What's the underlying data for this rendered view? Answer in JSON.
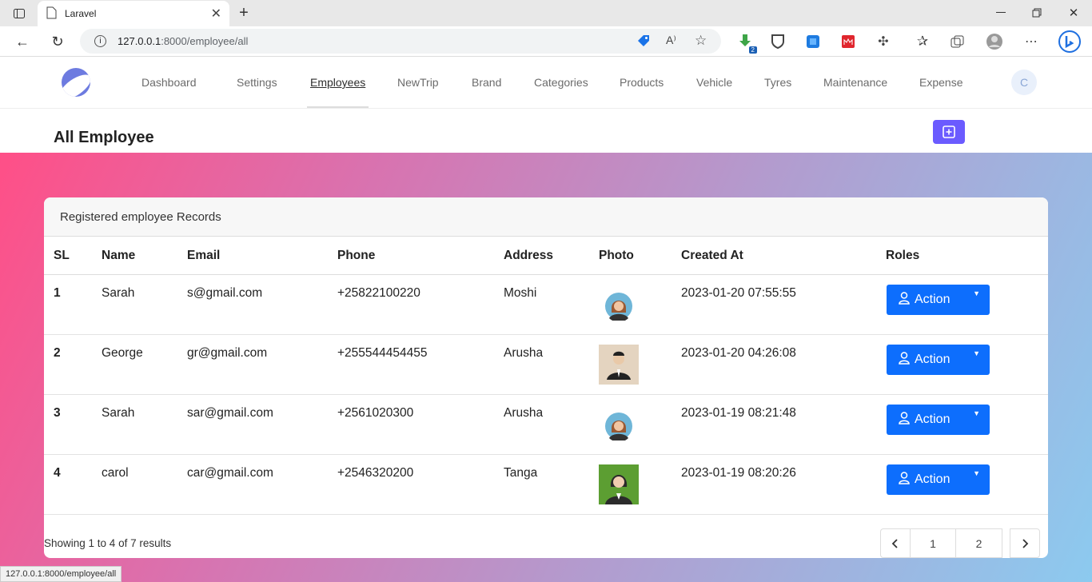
{
  "browser": {
    "tab_title": "Laravel",
    "url_host": "127.0.0.1",
    "url_rest": ":8000/employee/all",
    "status_url": "127.0.0.1:8000/employee/all",
    "extension_badge": "2"
  },
  "nav": {
    "items": [
      "Dashboard",
      "Settings",
      "Employees",
      "NewTrip",
      "Brand",
      "Categories",
      "Products",
      "Vehicle",
      "Tyres",
      "Maintenance",
      "Expense"
    ],
    "active": "Employees",
    "avatar_initial": "C"
  },
  "page": {
    "title": "All Employee",
    "card_title": "Registered employee Records"
  },
  "table": {
    "headers": [
      "SL",
      "Name",
      "Email",
      "Phone",
      "Address",
      "Photo",
      "Created At",
      "Roles"
    ],
    "rows": [
      {
        "sl": "1",
        "name": "Sarah",
        "email": "s@gmail.com",
        "phone": "+25822100220",
        "address": "Moshi",
        "photo": "female-avatar-icon",
        "created": "2023-01-20 07:55:55",
        "action": "Action"
      },
      {
        "sl": "2",
        "name": "George",
        "email": "gr@gmail.com",
        "phone": "+255544454455",
        "address": "Arusha",
        "photo": "man-in-suit-photo",
        "created": "2023-01-20 04:26:08",
        "action": "Action"
      },
      {
        "sl": "3",
        "name": "Sarah",
        "email": "sar@gmail.com",
        "phone": "+2561020300",
        "address": "Arusha",
        "photo": "female-avatar-icon",
        "created": "2023-01-19 08:21:48",
        "action": "Action"
      },
      {
        "sl": "4",
        "name": "carol",
        "email": "car@gmail.com",
        "phone": "+2546320200",
        "address": "Tanga",
        "photo": "woman-green-bg-photo",
        "created": "2023-01-19 08:20:26",
        "action": "Action"
      }
    ]
  },
  "pagination": {
    "info": "Showing 1 to 4 of 7 results",
    "pages": [
      "1",
      "2"
    ],
    "prev_icon": "chevron-left-icon",
    "next_icon": "chevron-right-icon"
  },
  "colors": {
    "accent": "#0d6efd",
    "add_button": "#6b5bff"
  }
}
